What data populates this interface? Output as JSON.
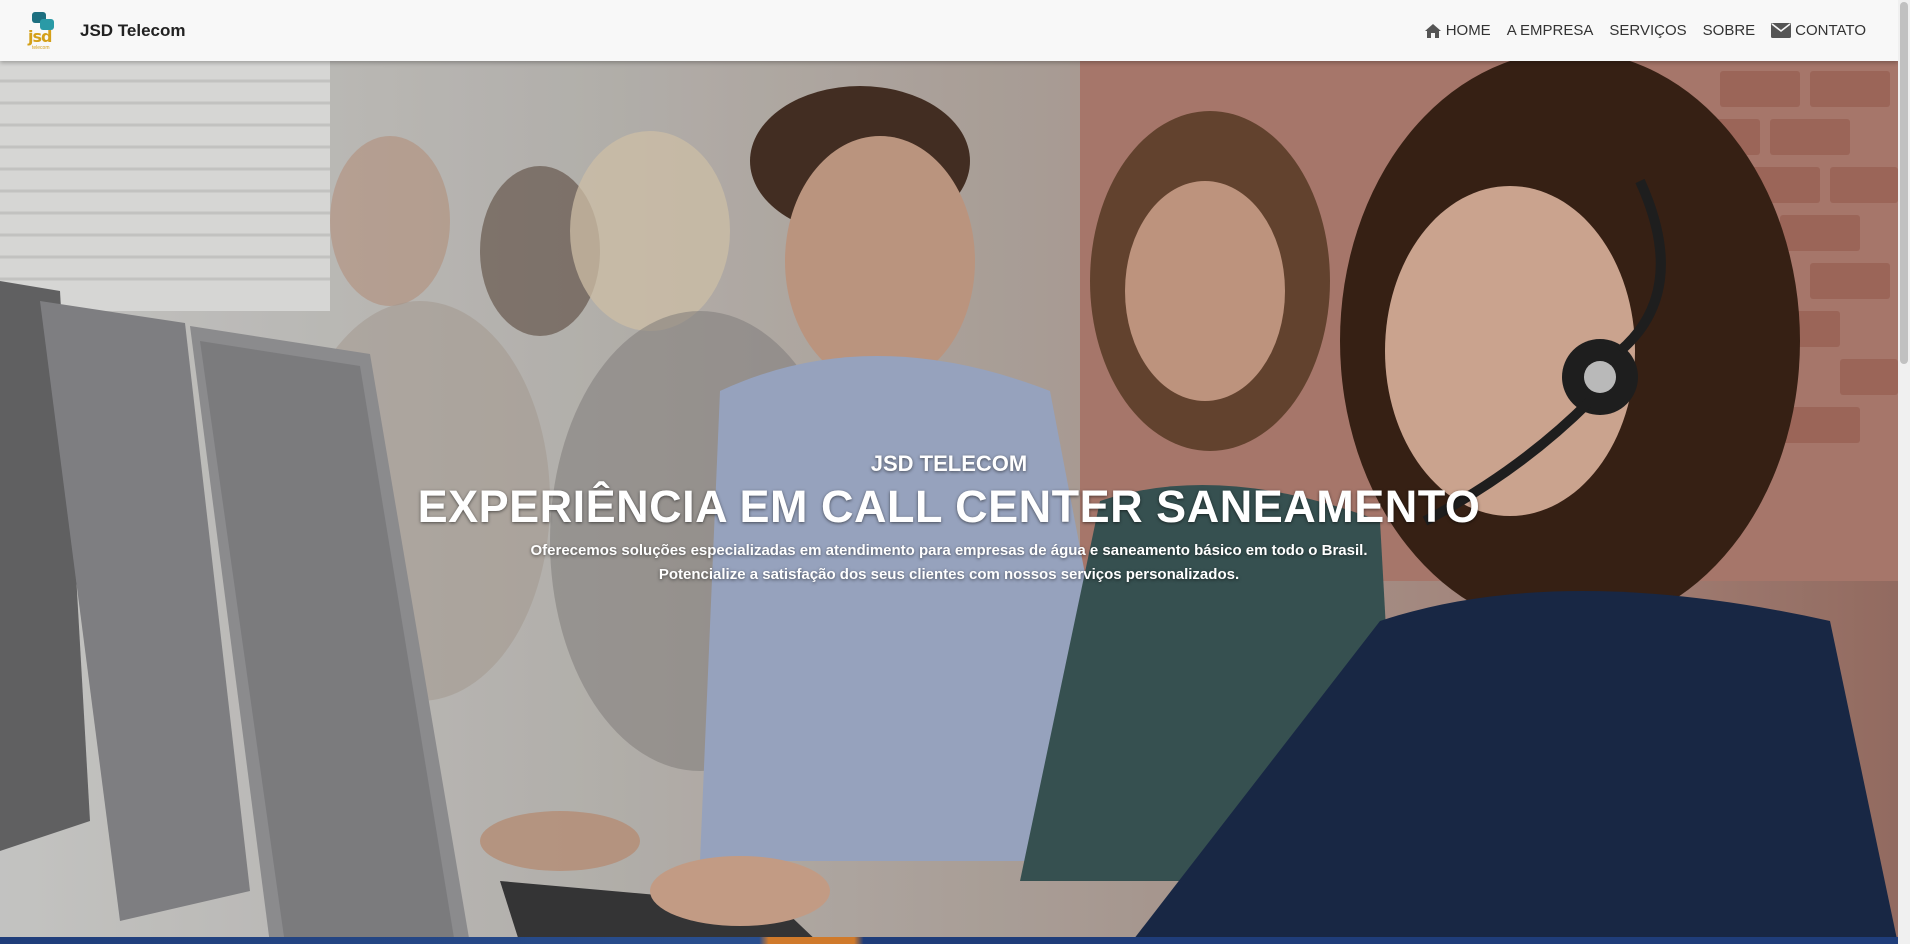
{
  "header": {
    "brand_name": "JSD Telecom",
    "logo_text": "jsd",
    "logo_subtext": "telecom",
    "nav": {
      "home": "HOME",
      "empresa": "A EMPRESA",
      "servicos": "SERVIÇOS",
      "sobre": "SOBRE",
      "contato": "CONTATO"
    },
    "icons": {
      "home": "home-icon",
      "contato": "envelope-icon"
    }
  },
  "hero": {
    "eyebrow": "JSD TELECOM",
    "title": "EXPERIÊNCIA EM CALL CENTER SANEAMENTO",
    "description_line1": "Oferecemos soluções especializadas em atendimento para empresas de água e saneamento básico em todo o Brasil.",
    "description_line2": "Potencialize a satisfação dos seus clientes com nossos serviços personalizados."
  },
  "colors": {
    "header_bg": "#f8f8f8",
    "logo_teal": "#1d6f80",
    "logo_gold": "#d4a019",
    "hero_text": "#ffffff"
  }
}
